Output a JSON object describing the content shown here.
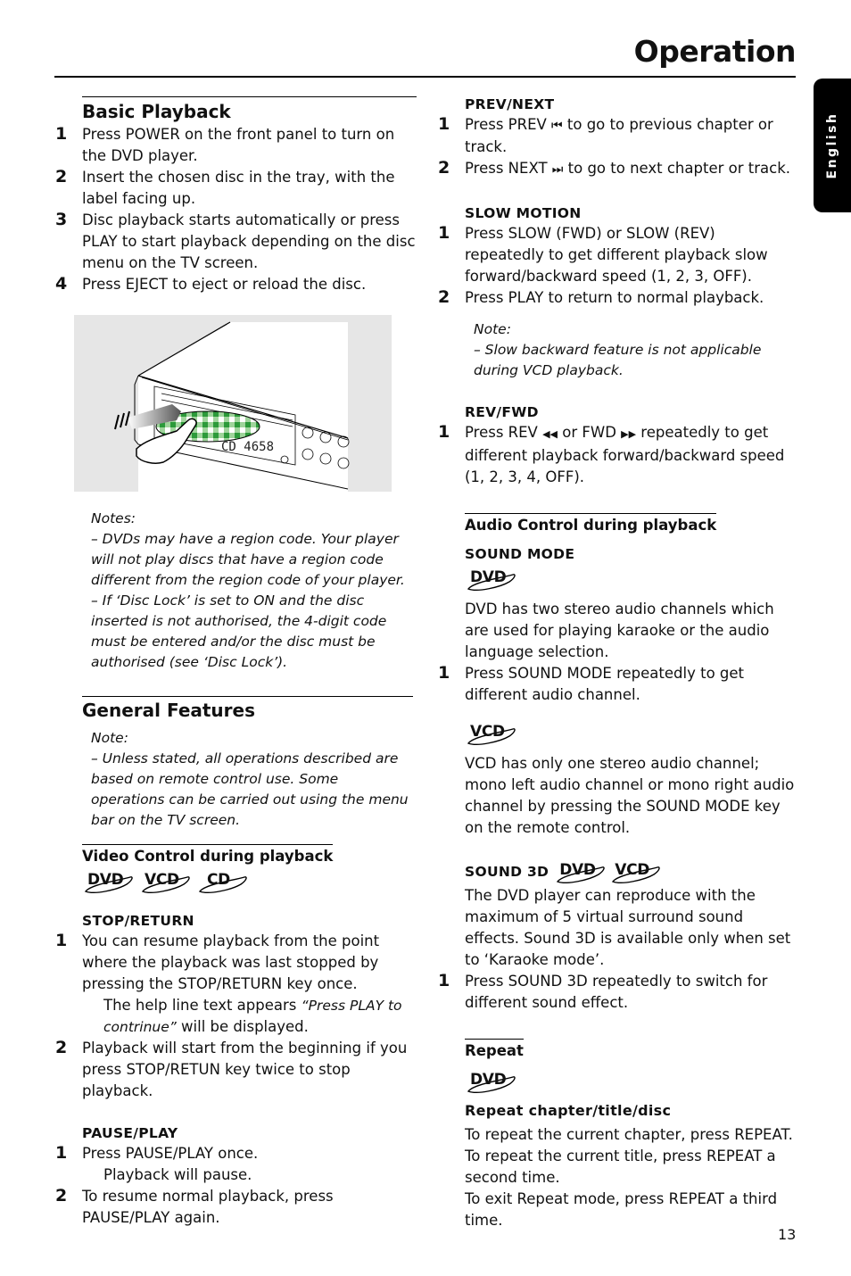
{
  "header": {
    "title": "Operation",
    "language_tab": "English"
  },
  "page_number": "13",
  "left": {
    "basic_playback": {
      "heading": "Basic Playback",
      "steps": [
        {
          "num": "1",
          "text": "Press POWER on the front panel to turn on the DVD player."
        },
        {
          "num": "2",
          "text": "Insert the chosen disc in the tray, with the label facing up."
        },
        {
          "num": "3",
          "text": "Disc playback starts automatically or press PLAY to start playback depending on the disc menu on the TV screen."
        },
        {
          "num": "4",
          "text": "Press EJECT to eject or reload the disc."
        }
      ],
      "figure": {
        "description": "Hand inserting a disc into DVD player tray",
        "display_readout": "4658"
      },
      "notes": {
        "label": "Notes:",
        "items": [
          "–    DVDs may have a region code. Your player will not play discs that have a region code different from the region code of  your player.",
          "–    If ‘Disc Lock’ is set to ON and the disc inserted is not authorised, the 4-digit code must be entered and/or the disc must be authorised (see ‘Disc Lock’)."
        ]
      }
    },
    "general_features": {
      "heading": "General Features",
      "note": {
        "label": "Note:",
        "text": "–    Unless stated, all operations described are based on remote control use. Some operations can be carried out using the menu bar on the TV screen."
      }
    },
    "video_control": {
      "heading": "Video Control during playback",
      "disc_types": [
        "DVD",
        "VCD",
        "CD"
      ],
      "stop_return": {
        "heading": "STOP/RETURN",
        "step1_num": "1",
        "step1_text": "You can resume playback from the point where the playback was last stopped by pressing the STOP/RETURN key once.",
        "help_prefix": "The help line text appears ",
        "help_quote": "“Press PLAY to contrinue”",
        "help_suffix": " will be displayed.",
        "step2_num": "2",
        "step2_text": "Playback will start from the beginning if you press STOP/RETUN key twice to stop playback."
      },
      "pause_play": {
        "heading": "PAUSE/PLAY",
        "step1_num": "1",
        "step1_text": "Press PAUSE/PLAY once.",
        "step1_result": "Playback will pause.",
        "step2_num": "2",
        "step2_text": "To resume normal playback, press PAUSE/PLAY again."
      }
    }
  },
  "right": {
    "prev_next": {
      "heading": "PREV/NEXT",
      "step1_num": "1",
      "step1_a": "Press PREV ",
      "step1_icon": "⏮",
      "step1_b": " to go to previous chapter or track.",
      "step2_num": "2",
      "step2_a": "Press NEXT ",
      "step2_icon": "⏭",
      "step2_b": " to go to next chapter or track."
    },
    "slow_motion": {
      "heading": "SLOW MOTION",
      "step1_num": "1",
      "step1_text": "Press SLOW (FWD) or SLOW (REV) repeatedly to get different playback slow forward/backward speed (1, 2, 3, OFF).",
      "step2_num": "2",
      "step2_text": "Press PLAY to return to normal playback.",
      "note_label": "Note:",
      "note_text": "–    Slow backward feature is not applicable during VCD playback."
    },
    "rev_fwd": {
      "heading": "REV/FWD",
      "step1_num": "1",
      "step1_a": "Press REV ",
      "rev_icon": "◀◀",
      "step1_b": " or FWD ",
      "fwd_icon": "▶▶",
      "step1_c": " repeatedly to get different playback forward/backward speed (1, 2, 3, 4, OFF)."
    },
    "audio_control": {
      "heading": "Audio Control during playback",
      "sound_mode": {
        "heading": "SOUND MODE",
        "dvd_logo": "DVD",
        "dvd_text": "DVD has two stereo audio channels which are used for playing karaoke or the audio language selection.",
        "step1_num": "1",
        "step1_text": "Press SOUND MODE repeatedly to get different audio channel.",
        "vcd_logo": "VCD",
        "vcd_text": "VCD has only one stereo audio channel; mono left audio channel or mono right audio channel by pressing the SOUND MODE key on the remote control."
      },
      "sound_3d": {
        "heading": "SOUND 3D",
        "disc_types": [
          "DVD",
          "VCD"
        ],
        "text": "The DVD player can reproduce with the maximum of 5 virtual surround sound effects. Sound 3D is available only when set to ‘Karaoke mode’.",
        "step1_num": "1",
        "step1_text": "Press SOUND 3D repeatedly to switch for different sound effect."
      }
    },
    "repeat": {
      "heading": "Repeat",
      "disc_logo": "DVD",
      "subheading": "Repeat chapter/title/disc",
      "lines": [
        "To repeat the current chapter, press REPEAT.",
        "To repeat the current title, press REPEAT a second time.",
        "To exit Repeat mode, press REPEAT a third time."
      ]
    }
  }
}
